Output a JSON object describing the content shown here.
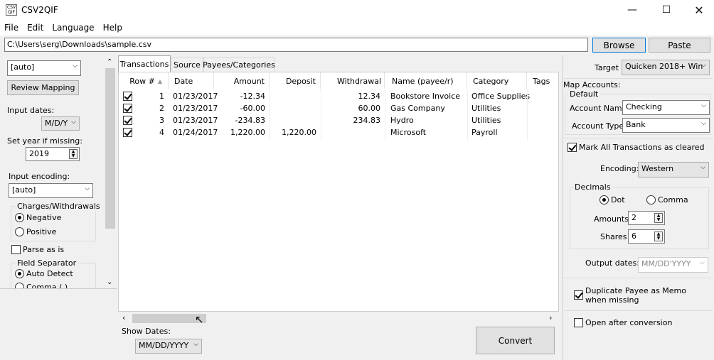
{
  "window": {
    "title": "CSV2QIF",
    "icon_text": "CSV\nQIF"
  },
  "menu": [
    "File",
    "Edit",
    "Language",
    "Help"
  ],
  "path": {
    "value": "C:\\Users\\serg\\Downloads\\sample.csv"
  },
  "buttons": {
    "browse": "Browse",
    "paste": "Paste",
    "review_mapping": "Review Mapping",
    "convert": "Convert"
  },
  "left": {
    "mapping_combo": "[auto]",
    "input_dates_label": "Input dates:",
    "input_dates_value": "M/D/Y",
    "set_year_label": "Set year if missing:",
    "set_year_value": "2019",
    "input_encoding_label": "Input encoding:",
    "input_encoding_value": "[auto]",
    "charges_group": "Charges/Withdrawals",
    "charges_negative": "Negative",
    "charges_positive": "Positive",
    "parse_as_is": "Parse as is",
    "field_sep_group": "Field Separator",
    "field_sep_auto": "Auto Detect",
    "field_sep_comma": "Comma (,)"
  },
  "tabs": [
    "Transactions",
    "Source",
    "Payees/Categories"
  ],
  "table": {
    "columns": [
      "Row #",
      "Date",
      "Amount",
      "Deposit",
      "Withdrawal",
      "Name (payee/r)",
      "Category",
      "Tags"
    ],
    "rows": [
      {
        "row": "1",
        "date": "01/23/2017",
        "amount": "-12.34",
        "deposit": "",
        "withdrawal": "12.34",
        "name": "Bookstore Invoice",
        "category": "Office Supplies"
      },
      {
        "row": "2",
        "date": "01/23/2017",
        "amount": "-60.00",
        "deposit": "",
        "withdrawal": "60.00",
        "name": "Gas Company",
        "category": "Utilities"
      },
      {
        "row": "3",
        "date": "01/23/2017",
        "amount": "-234.83",
        "deposit": "",
        "withdrawal": "234.83",
        "name": "Hydro",
        "category": "Utilities"
      },
      {
        "row": "4",
        "date": "01/24/2017",
        "amount": "1,220.00",
        "deposit": "1,220.00",
        "withdrawal": "",
        "name": "Microsoft",
        "category": "Payroll"
      }
    ]
  },
  "bottom": {
    "show_dates_label": "Show Dates:",
    "show_dates_value": "MM/DD/YYYY"
  },
  "right": {
    "target_label": "Target",
    "target_value": "Quicken 2018+ Win",
    "map_accounts_label": "Map Accounts:",
    "default_group": "Default",
    "account_name_label": "Account Name:",
    "account_name_value": "Checking",
    "account_type_label": "Account Type:",
    "account_type_value": "Bank",
    "mark_cleared": "Mark All Transactions as cleared",
    "encoding_label": "Encoding:",
    "encoding_value": "Western",
    "decimals_group": "Decimals",
    "dot": "Dot",
    "comma": "Comma",
    "amounts_label": "Amounts",
    "amounts_value": "2",
    "shares_label": "Shares",
    "shares_value": "6",
    "output_dates_label": "Output dates:",
    "output_dates_value": "MM/DD'YYYY",
    "duplicate_payee": "Duplicate Payee as Memo when missing",
    "open_after": "Open after conversion"
  }
}
